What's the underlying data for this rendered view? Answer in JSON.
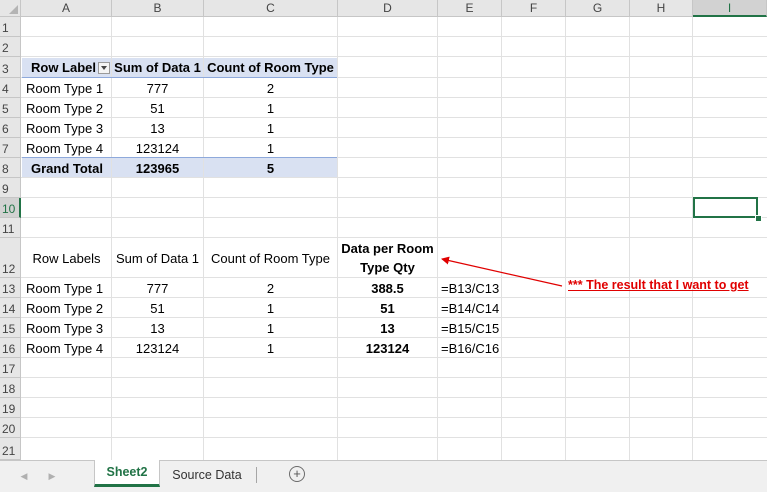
{
  "columns": [
    "A",
    "B",
    "C",
    "D",
    "E",
    "F",
    "G",
    "H",
    "I"
  ],
  "rows": [
    "1",
    "2",
    "3",
    "4",
    "5",
    "6",
    "7",
    "8",
    "9",
    "10",
    "11",
    "12",
    "13",
    "14",
    "15",
    "16",
    "17",
    "18",
    "19",
    "20",
    "21"
  ],
  "pivot": {
    "header": {
      "row_labels": "Row Label",
      "sum_data": "Sum of Data 1",
      "count_room": "Count of Room Type"
    },
    "rows": [
      {
        "label": "Room Type 1",
        "sum": "777",
        "count": "2"
      },
      {
        "label": "Room Type 2",
        "sum": "51",
        "count": "1"
      },
      {
        "label": "Room Type 3",
        "sum": "13",
        "count": "1"
      },
      {
        "label": "Room Type 4",
        "sum": "123124",
        "count": "1"
      }
    ],
    "total": {
      "label": "Grand Total",
      "sum": "123965",
      "count": "5"
    }
  },
  "table2": {
    "header": {
      "row_labels": "Row Labels",
      "sum_data": "Sum of Data 1",
      "count_room": "Count of Room Type",
      "per_qty_line1": "Data per Room",
      "per_qty_line2": "Type Qty"
    },
    "rows": [
      {
        "label": "Room Type 1",
        "sum": "777",
        "count": "2",
        "per": "388.5",
        "formula": "=B13/C13"
      },
      {
        "label": "Room Type 2",
        "sum": "51",
        "count": "1",
        "per": "51",
        "formula": "=B14/C14"
      },
      {
        "label": "Room Type 3",
        "sum": "13",
        "count": "1",
        "per": "13",
        "formula": "=B15/C15"
      },
      {
        "label": "Room Type 4",
        "sum": "123124",
        "count": "1",
        "per": "123124",
        "formula": "=B16/C16"
      }
    ]
  },
  "annotation": "*** The result that I want to get",
  "sheet_tabs": [
    {
      "label": "Sheet2",
      "active": true
    },
    {
      "label": "Source Data",
      "active": false
    }
  ],
  "colors": {
    "accent": "#217346",
    "pivot_band": "#d9e1f2",
    "annotation": "#e00000"
  }
}
